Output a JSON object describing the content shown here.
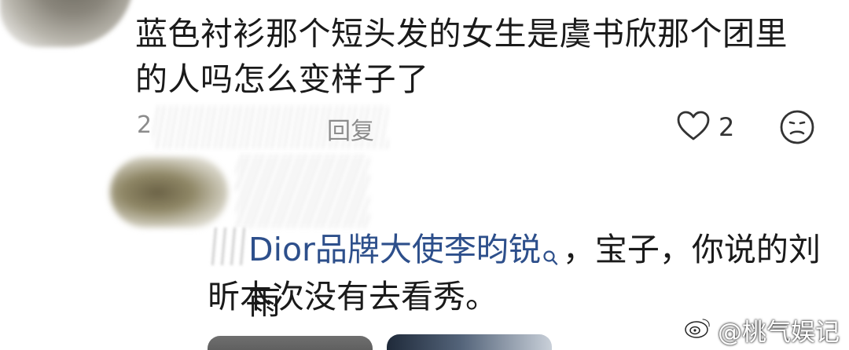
{
  "comment": {
    "text": "蓝色衬衫那个短头发的女生是虞书欣那个团里的人吗怎么变样子了",
    "date_partial": "2",
    "reply_label": "回复",
    "like_count": "2",
    "like_icon": "heart-outline-icon",
    "dislike_icon": "frown-face-icon"
  },
  "reply": {
    "link_text": "Dior品牌大使李昀锐",
    "link_icon": "search-icon",
    "text_line1_after_link": "，宝子，你说的刘雨",
    "text_line2": "昕本次没有去看秀。",
    "link_color": "#2d4f8b"
  },
  "watermark": {
    "text": "@桃气娱记",
    "icon": "weibo-logo-icon"
  }
}
